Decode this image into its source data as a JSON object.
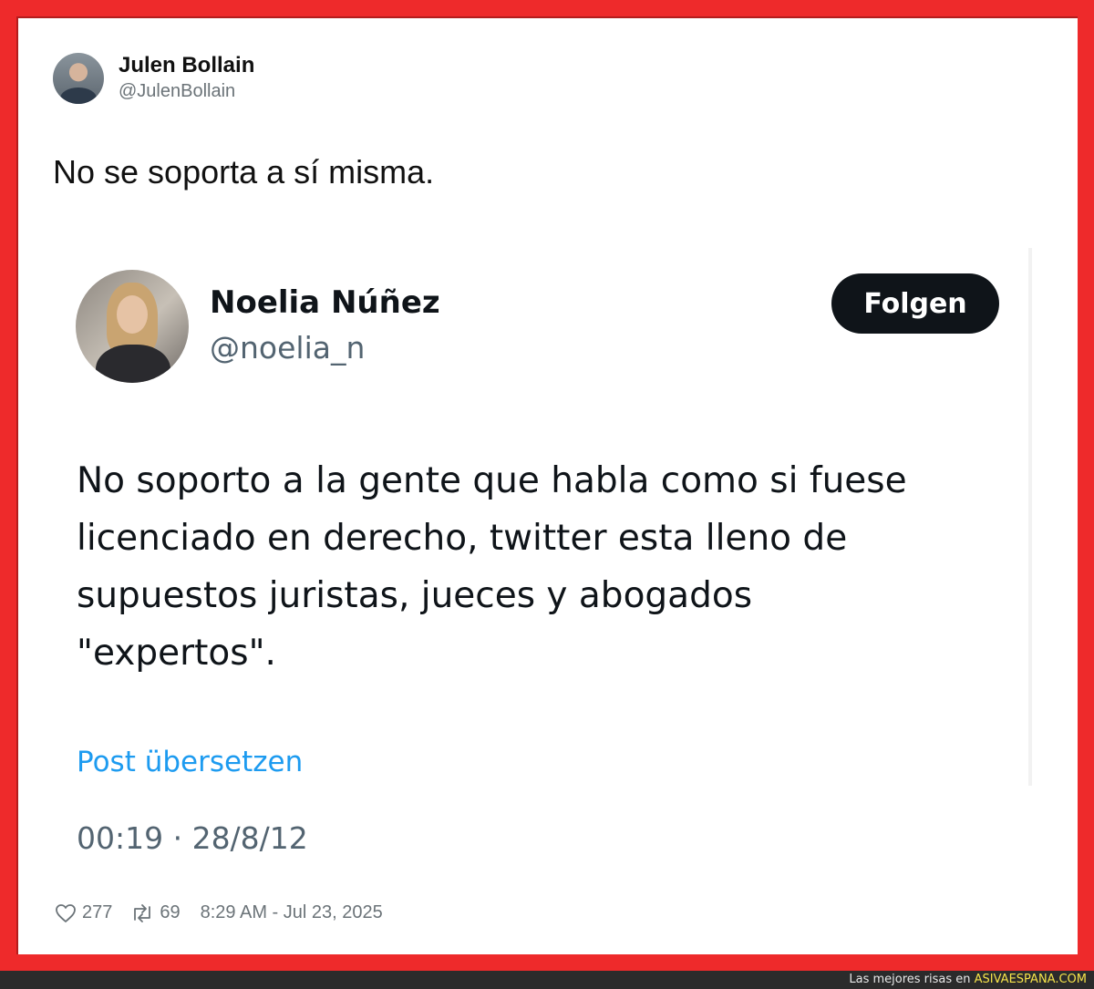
{
  "tweet": {
    "author_name": "Julen Bollain",
    "author_handle": "@JulenBollain",
    "text": "No se soporta a sí misma.",
    "likes": "277",
    "retweets": "69",
    "timestamp": "8:29 AM - Jul 23, 2025"
  },
  "quoted": {
    "author_name": "Noelia Núñez",
    "author_handle": "@noelia_n",
    "follow_label": "Folgen",
    "text_lines": [
      "No soporto a la gente que habla como si fuese",
      "licenciado en derecho, twitter esta lleno de",
      "supuestos juristas, jueces y abogados",
      "\"expertos\"."
    ],
    "translate_label": "Post übersetzen",
    "timestamp": "00:19 · 28/8/12"
  },
  "footer": {
    "prefix": "Las mejores risas en ",
    "brand": "ASIVAESPANA.COM"
  },
  "colors": {
    "frame": "#ee2a2b",
    "link": "#1d9bf0",
    "button_bg": "#0f1419",
    "muted": "#536471"
  },
  "icons": {
    "like": "heart-icon",
    "retweet": "retweet-icon"
  }
}
